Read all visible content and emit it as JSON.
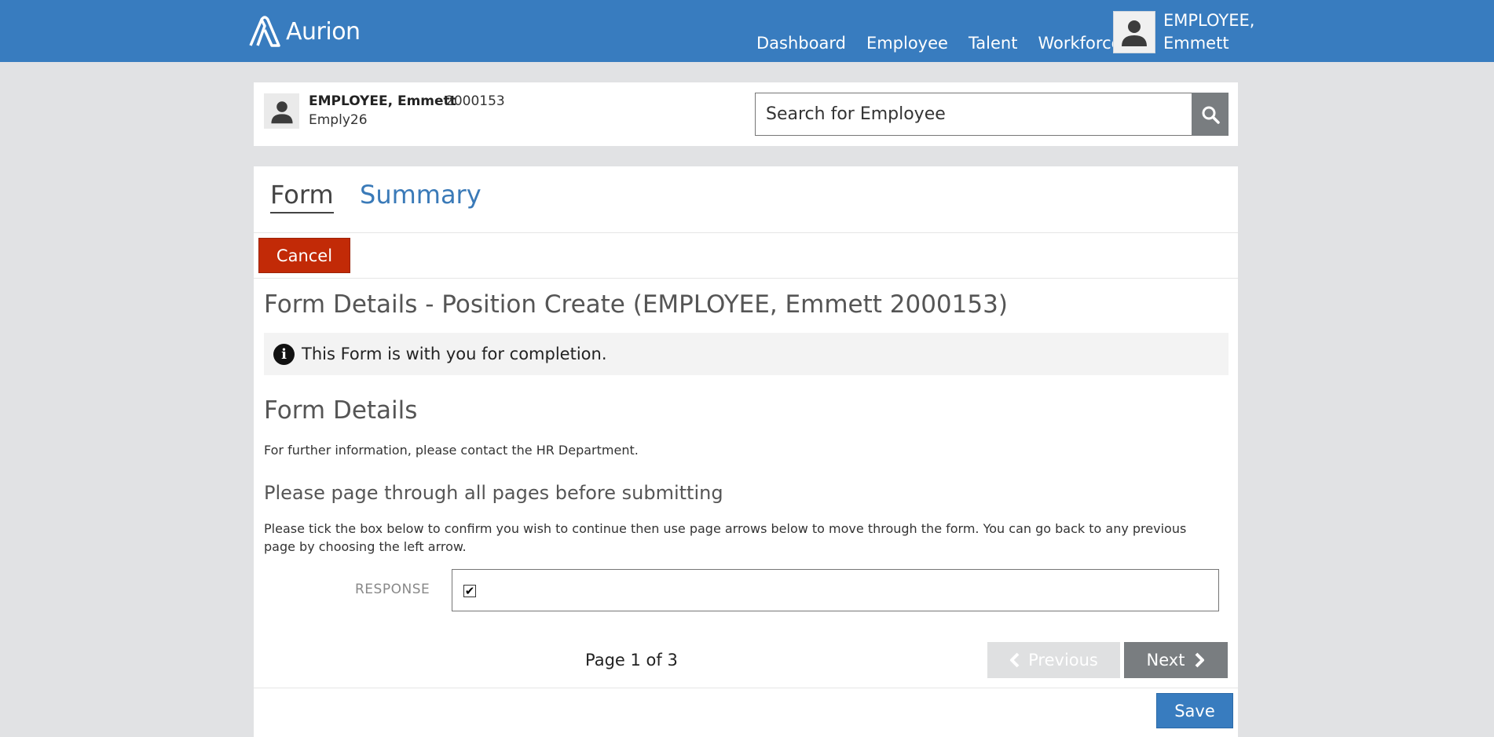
{
  "header": {
    "brand": "Aurion",
    "nav": [
      {
        "label": "Dashboard"
      },
      {
        "label": "Employee"
      },
      {
        "label": "Talent"
      },
      {
        "label": "Workforce"
      }
    ],
    "user": {
      "name_line1": "EMPLOYEE,",
      "name_line2": "Emmett"
    }
  },
  "employee": {
    "name": "EMPLOYEE, Emmett",
    "id": "2000153",
    "code": "Emply26"
  },
  "search": {
    "placeholder": "Search for Employee"
  },
  "tabs": [
    {
      "label": "Form",
      "active": true
    },
    {
      "label": "Summary",
      "active": false
    }
  ],
  "actions": {
    "cancel_label": "Cancel",
    "save_label": "Save"
  },
  "form": {
    "title": "Form Details - Position Create (EMPLOYEE, Emmett 2000153)",
    "info_message": "This Form is with you for completion.",
    "section_heading": "Form Details",
    "contact_text": "For further information, please contact the HR Department.",
    "sub_heading": "Please page through all pages before submitting",
    "instructions": "Please tick the box below to confirm you wish to continue then use page arrows below to move through the form. You can go back to any previous page by choosing the left arrow.",
    "response_label": "RESPONSE",
    "response_checked": true
  },
  "pagination": {
    "page_text": "Page 1 of 3",
    "previous_label": "Previous",
    "next_label": "Next"
  },
  "colors": {
    "header_bg": "#387cbf",
    "cancel_bg": "#c22a07",
    "save_bg": "#387cbf",
    "next_bg": "#797d80",
    "previous_bg": "#dfe0e1",
    "page_bg": "#e1e2e4"
  },
  "icons": {
    "logo": "aurion-logo-icon",
    "user_avatar": "user-silhouette-icon",
    "search": "search-icon",
    "info": "info-icon",
    "checkbox": "checkmark-icon",
    "previous": "chevron-left-icon",
    "next": "chevron-right-icon"
  }
}
